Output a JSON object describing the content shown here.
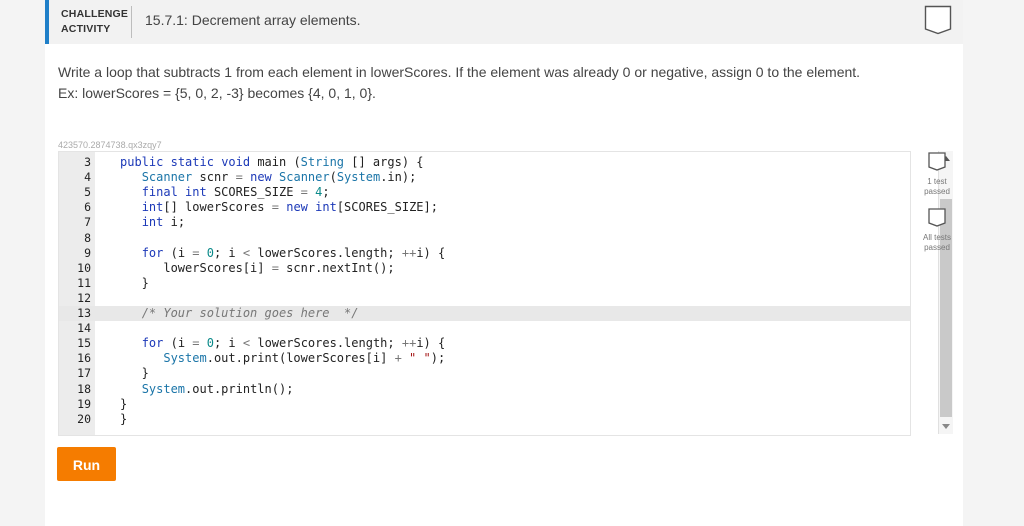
{
  "header": {
    "label_line1": "CHALLENGE",
    "label_line2": "ACTIVITY",
    "title": "15.7.1: Decrement array elements."
  },
  "prompt": {
    "line1": "Write a loop that subtracts 1 from each element in lowerScores. If the element was already 0 or negative, assign 0 to the element.",
    "line2": "Ex: lowerScores = {5, 0, 2, -3} becomes {4, 0, 1, 0}."
  },
  "editor": {
    "id_text": "423570.2874738.qx3zqy7",
    "active_line": "13",
    "lines": [
      {
        "n": "3",
        "code": "public static void main (String [] args) {"
      },
      {
        "n": "4",
        "code": "   Scanner scnr = new Scanner(System.in);"
      },
      {
        "n": "5",
        "code": "   final int SCORES_SIZE = 4;"
      },
      {
        "n": "6",
        "code": "   int[] lowerScores = new int[SCORES_SIZE];"
      },
      {
        "n": "7",
        "code": "   int i;"
      },
      {
        "n": "8",
        "code": ""
      },
      {
        "n": "9",
        "code": "   for (i = 0; i < lowerScores.length; ++i) {"
      },
      {
        "n": "10",
        "code": "      lowerScores[i] = scnr.nextInt();"
      },
      {
        "n": "11",
        "code": "   }"
      },
      {
        "n": "12",
        "code": ""
      },
      {
        "n": "13",
        "code": "   /* Your solution goes here  */"
      },
      {
        "n": "14",
        "code": ""
      },
      {
        "n": "15",
        "code": "   for (i = 0; i < lowerScores.length; ++i) {"
      },
      {
        "n": "16",
        "code": "      System.out.print(lowerScores[i] + \" \");"
      },
      {
        "n": "17",
        "code": "   }"
      },
      {
        "n": "18",
        "code": "   System.out.println();"
      },
      {
        "n": "19",
        "code": "}"
      },
      {
        "n": "20",
        "code": "}"
      }
    ]
  },
  "tests": [
    {
      "label_line1": "1 test",
      "label_line2": "passed"
    },
    {
      "label_line1": "All tests",
      "label_line2": "passed"
    }
  ],
  "run_button": {
    "label": "Run"
  },
  "colors": {
    "accent": "#1f7fc8",
    "run": "#f57c00"
  }
}
